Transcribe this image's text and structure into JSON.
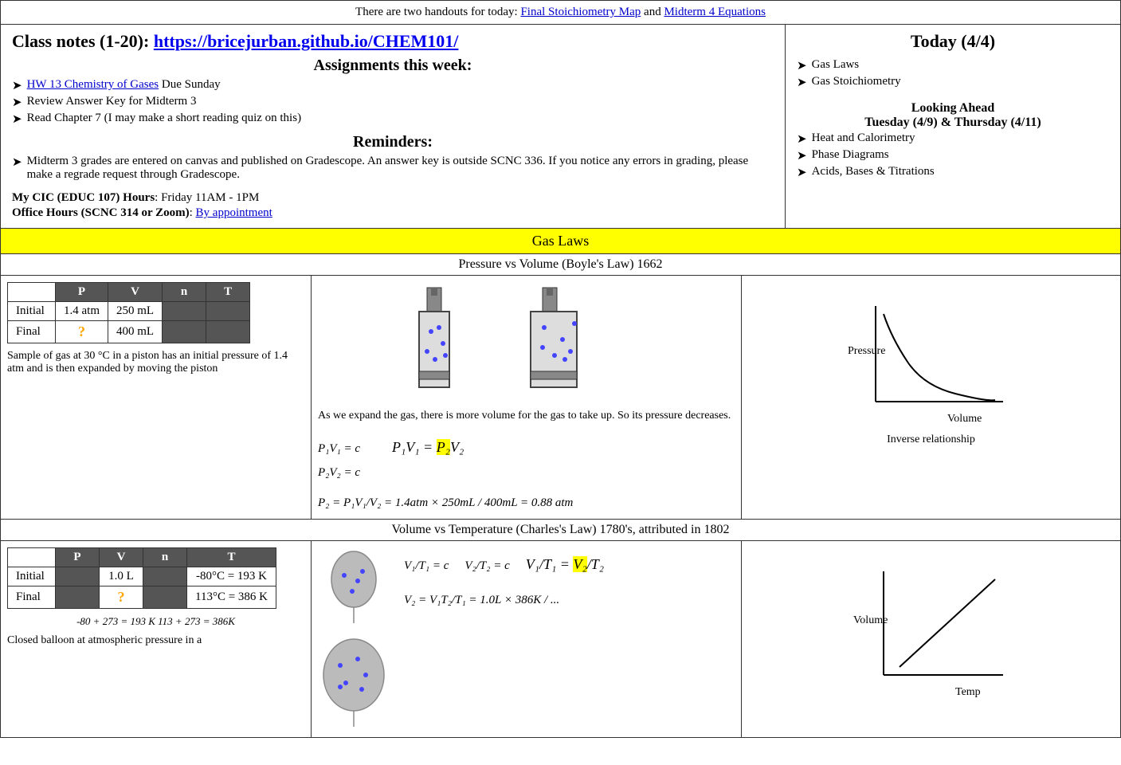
{
  "topBanner": {
    "text": "There are two handouts for today: ",
    "link1": {
      "label": "Final Stoichiometry Map",
      "href": "#"
    },
    "between": " and ",
    "link2": {
      "label": "Midterm 4 Equations",
      "href": "#"
    }
  },
  "leftPanel": {
    "classnotes": {
      "prefix": "Class notes (1-20): ",
      "link": {
        "label": "https://bricejurban.github.io/CHEM101/",
        "href": "https://bricejurban.github.io/CHEM101/"
      }
    },
    "assignmentsTitle": "Assignments this week:",
    "assignments": [
      {
        "text": "HW 13 Chemistry of Gases",
        "isLink": true,
        "suffix": " Due Sunday"
      },
      {
        "text": "Review Answer Key for Midterm 3",
        "isLink": false
      },
      {
        "text": "Read Chapter 7 (I may make a short reading quiz on this)",
        "isLink": false
      }
    ],
    "remindersTitle": "Reminders:",
    "reminder": "Midterm 3 grades are entered on canvas and published on Gradescope. An answer key is outside SCNC 336. If you notice any errors in grading, please make a regrade request through Gradescope.",
    "cicHours": {
      "label": "My CIC (EDUC 107) Hours",
      "value": ": Friday 11AM - 1PM"
    },
    "officeHours": {
      "label": "Office Hours (SCNC 314 or Zoom)",
      "link": {
        "label": "By appointment",
        "href": "#"
      },
      "prefix": ": "
    }
  },
  "rightPanel": {
    "todayTitle": "Today (4/4)",
    "items": [
      "Gas Laws",
      "Gas Stoichiometry"
    ],
    "lookingAhead": {
      "title1": "Looking Ahead",
      "title2": "Tuesday (4/9) & Thursday (4/11)",
      "items": [
        "Heat and Calorimetry",
        "Phase Diagrams",
        "Acids, Bases & Titrations"
      ]
    }
  },
  "gasLaws": {
    "sectionLabel": "Gas Laws",
    "boyle": {
      "title": "Pressure vs Volume (Boyle's Law) 1662",
      "tableHeaders": [
        "",
        "P",
        "V",
        "n",
        "T"
      ],
      "rows": [
        {
          "label": "Initial",
          "P": "1.4 atm",
          "V": "250 mL",
          "n": "",
          "T": ""
        },
        {
          "label": "Final",
          "P": "?",
          "V": "400 mL",
          "n": "",
          "T": ""
        }
      ],
      "description": "Sample of gas at 30 °C in a piston has an initial pressure of 1.4 atm and is then expanded by moving the piston",
      "textDescription": "As we expand the gas, there is more volume for the gas to take up. So its pressure decreases.",
      "graphLabel": "Inverse relationship",
      "xAxisLabel": "Volume",
      "yAxisLabel": "Pressure"
    },
    "charles": {
      "title": "Volume vs Temperature (Charles's Law) 1780's, attributed in 1802",
      "tableHeaders": [
        "",
        "P",
        "V",
        "n",
        "T"
      ],
      "rows": [
        {
          "label": "Initial",
          "P": "",
          "V": "1.0 L",
          "n": "",
          "T": "-80°C = 193 K"
        },
        {
          "label": "Final",
          "P": "",
          "V": "?",
          "n": "",
          "T": "113°C = 386 K"
        }
      ],
      "conversionNote": "-80 + 273 = 193 K    113 + 273 = 386K",
      "description": "Closed balloon at atmospheric pressure in a",
      "xAxisLabel": "Temp",
      "yAxisLabel": "Volume"
    }
  }
}
